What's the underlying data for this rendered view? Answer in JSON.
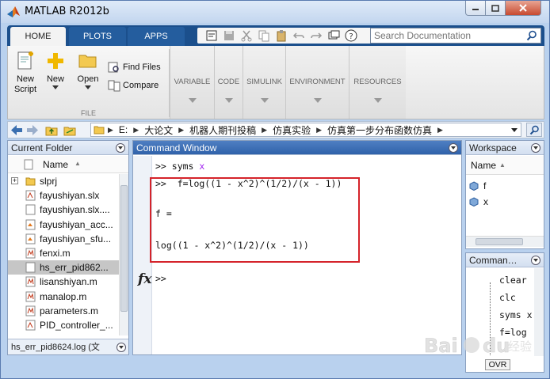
{
  "window": {
    "title": "MATLAB R2012b"
  },
  "ribbon": {
    "tabs": [
      {
        "label": "HOME"
      },
      {
        "label": "PLOTS"
      },
      {
        "label": "APPS"
      }
    ],
    "search": {
      "placeholder": "Search Documentation"
    },
    "file_group": {
      "label": "FILE",
      "new_script": "New\nScript",
      "new_script_l1": "New",
      "new_script_l2": "Script",
      "new": "New",
      "open": "Open",
      "find_files": "Find Files",
      "compare": "Compare"
    },
    "collapsed_sections": [
      "VARIABLE",
      "CODE",
      "SIMULINK",
      "ENVIRONMENT",
      "RESOURCES"
    ]
  },
  "address": {
    "crumbs": [
      "E:",
      "大论文",
      "机器人期刊投稿",
      "仿真实验",
      "仿真第一步分布函数仿真"
    ]
  },
  "current_folder": {
    "title": "Current Folder",
    "column": "Name",
    "sort_indicator": "▲",
    "items": [
      {
        "name": "slprj",
        "type": "folder"
      },
      {
        "name": "fayushiyan.slx",
        "type": "slx"
      },
      {
        "name": "fayushiyan.slx....",
        "type": "file"
      },
      {
        "name": "fayushiyan_acc...",
        "type": "mex"
      },
      {
        "name": "fayushiyan_sfu...",
        "type": "mex"
      },
      {
        "name": "fenxi.m",
        "type": "m"
      },
      {
        "name": "hs_err_pid862...",
        "type": "file"
      },
      {
        "name": "lisanshiyan.m",
        "type": "m"
      },
      {
        "name": "manalop.m",
        "type": "m"
      },
      {
        "name": "parameters.m",
        "type": "m"
      },
      {
        "name": "PID_controller_...",
        "type": "slx"
      }
    ],
    "selected_index": 6,
    "status": "hs_err_pid8624.log (文"
  },
  "command_window": {
    "title": "Command Window",
    "lines": {
      "l1_prompt": ">> syms ",
      "l1_kw": "x",
      "l2": ">>  f=log((1 - x^2)^(1/2)/(x - 1))",
      "l3": "f =",
      "l4": "log((1 - x^2)^(1/2)/(x - 1))",
      "prompt": ">>"
    },
    "fx_label": "fx"
  },
  "workspace": {
    "title": "Workspace",
    "column": "Name",
    "sort_indicator": "▲",
    "variables": [
      "f",
      "x"
    ]
  },
  "command_history": {
    "title": "Comman…",
    "entries": [
      "clear",
      "clc",
      "syms x",
      "f=log"
    ],
    "ovr": "OVR"
  },
  "colors": {
    "ribbon_tab_bg": "#1b4f8c",
    "active_panel_head": "#2f62aa",
    "highlight_box": "#d5232a",
    "keyword": "#a020f0"
  }
}
